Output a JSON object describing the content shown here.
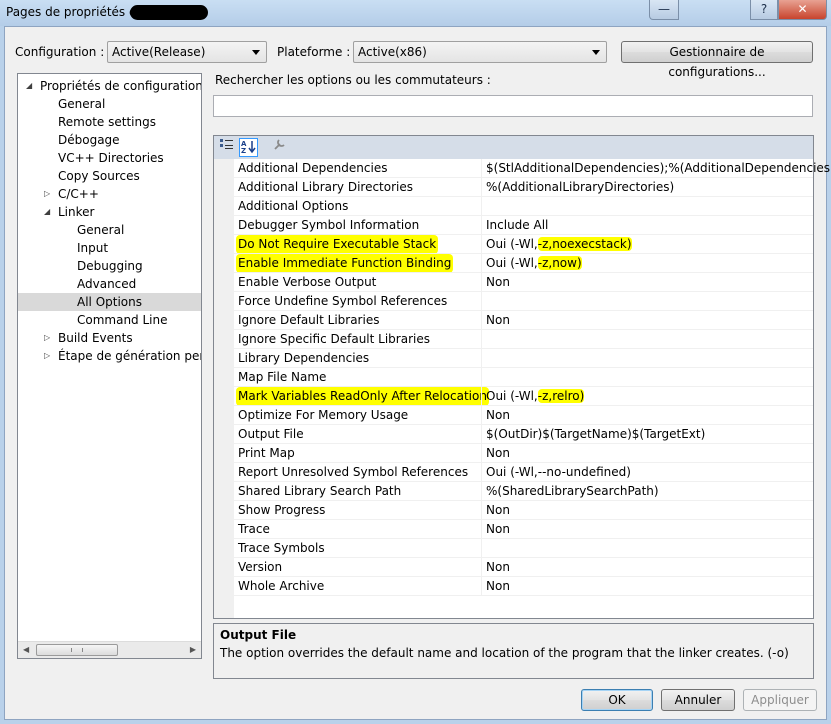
{
  "window": {
    "title": "Pages de propriétés de",
    "minimize_glyph": "—",
    "help_glyph": "?",
    "close_glyph": "✕"
  },
  "toolbar": {
    "configuration_label": "Configuration :",
    "configuration_value": "Active(Release)",
    "platform_label": "Plateforme :",
    "platform_value": "Active(x86)",
    "config_manager_label": "Gestionnaire de configurations..."
  },
  "tree": {
    "items": [
      {
        "label": "Propriétés de configuration",
        "expander": "◢"
      },
      {
        "label": "General"
      },
      {
        "label": "Remote settings"
      },
      {
        "label": "Débogage"
      },
      {
        "label": "VC++ Directories"
      },
      {
        "label": "Copy Sources"
      },
      {
        "label": "C/C++",
        "expander": "▷"
      },
      {
        "label": "Linker",
        "expander": "◢"
      },
      {
        "label": "General"
      },
      {
        "label": "Input"
      },
      {
        "label": "Debugging"
      },
      {
        "label": "Advanced"
      },
      {
        "label": "All Options",
        "selected": true
      },
      {
        "label": "Command Line"
      },
      {
        "label": "Build Events",
        "expander": "▷"
      },
      {
        "label": "Étape de génération person",
        "expander": "▷"
      }
    ]
  },
  "search": {
    "label": "Rechercher les options ou les commutateurs :",
    "value": ""
  },
  "grid": {
    "rows": [
      {
        "name": "Additional Dependencies",
        "value": "$(StlAdditionalDependencies);%(AdditionalDependencies)"
      },
      {
        "name": "Additional Library Directories",
        "value": "%(AdditionalLibraryDirectories)"
      },
      {
        "name": "Additional Options",
        "value": ""
      },
      {
        "name": "Debugger Symbol Information",
        "value": "Include All"
      },
      {
        "name": "Do Not Require Executable Stack",
        "value_prefix": "Oui (-Wl,",
        "value_hl": "-z,noexecstack)",
        "highlighted": true
      },
      {
        "name": "Enable Immediate Function Binding",
        "value_prefix": "Oui (-Wl,",
        "value_hl": "-z,now)",
        "highlighted": true
      },
      {
        "name": "Enable Verbose Output",
        "value": "Non"
      },
      {
        "name": "Force Undefine Symbol References",
        "value": ""
      },
      {
        "name": "Ignore Default Libraries",
        "value": "Non"
      },
      {
        "name": "Ignore Specific Default Libraries",
        "value": ""
      },
      {
        "name": "Library Dependencies",
        "value": ""
      },
      {
        "name": "Map File Name",
        "value": ""
      },
      {
        "name": "Mark Variables ReadOnly After Relocation",
        "value_prefix": "Oui (-Wl,",
        "value_hl": "-z,relro)",
        "highlighted": true
      },
      {
        "name": "Optimize For Memory Usage",
        "value": "Non"
      },
      {
        "name": "Output File",
        "value": "$(OutDir)$(TargetName)$(TargetExt)"
      },
      {
        "name": "Print Map",
        "value": "Non"
      },
      {
        "name": "Report Unresolved Symbol References",
        "value": "Oui (-Wl,--no-undefined)"
      },
      {
        "name": "Shared Library Search Path",
        "value": "%(SharedLibrarySearchPath)"
      },
      {
        "name": "Show Progress",
        "value": "Non"
      },
      {
        "name": "Trace",
        "value": "Non"
      },
      {
        "name": "Trace Symbols",
        "value": ""
      },
      {
        "name": "Version",
        "value": "Non"
      },
      {
        "name": "Whole Archive",
        "value": "Non"
      }
    ]
  },
  "description": {
    "title": "Output File",
    "text": "The option overrides the default name and location of the program that the linker creates. (-o)"
  },
  "buttons": {
    "ok": "OK",
    "cancel": "Annuler",
    "apply": "Appliquer"
  },
  "colors": {
    "highlight": "#ffff00",
    "selection": "#d9d9d9",
    "toolbar_bg": "#d5dde8"
  }
}
